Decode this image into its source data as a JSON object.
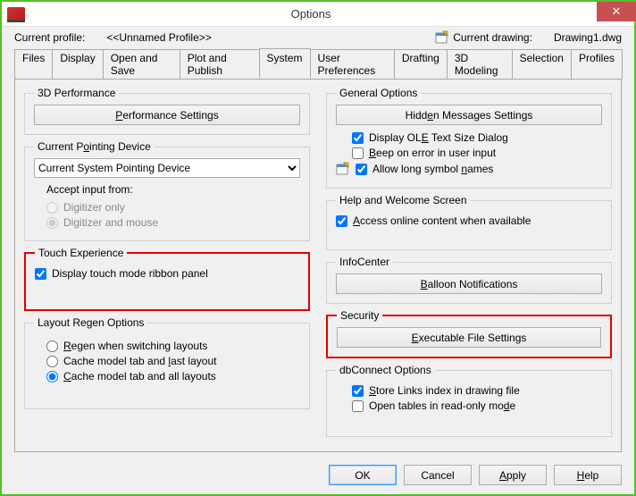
{
  "window": {
    "title": "Options"
  },
  "header": {
    "profile_label": "Current profile:",
    "profile_value": "<<Unnamed Profile>>",
    "drawing_label": "Current drawing:",
    "drawing_value": "Drawing1.dwg"
  },
  "tabs": [
    "Files",
    "Display",
    "Open and Save",
    "Plot and Publish",
    "System",
    "User Preferences",
    "Drafting",
    "3D Modeling",
    "Selection",
    "Profiles"
  ],
  "active_tab": "System",
  "left": {
    "perf_legend": "3D Performance",
    "perf_btn": "Performance Settings",
    "cpd_legend": "Current Pointing Device",
    "cpd_value": "Current System Pointing Device",
    "accept_label": "Accept input from:",
    "radio_digitizer_only": "Digitizer only",
    "radio_digitizer_mouse": "Digitizer and mouse",
    "touch_legend": "Touch Experience",
    "touch_check": "Display touch mode ribbon panel",
    "layout_legend": "Layout Regen Options",
    "radio_regen": "Regen when switching layouts",
    "radio_cache_last": "Cache model tab and last layout",
    "radio_cache_all": "Cache model tab and all layouts"
  },
  "right": {
    "general_legend": "General Options",
    "hidden_btn": "Hidden Messages Settings",
    "ole_check": "Display OLE Text Size Dialog",
    "beep_check": "Beep on error in user input",
    "long_check": "Allow long symbol names",
    "help_legend": "Help and Welcome Screen",
    "access_check": "Access online content when available",
    "info_legend": "InfoCenter",
    "balloon_btn": "Balloon Notifications",
    "security_legend": "Security",
    "exec_btn": "Executable File Settings",
    "db_legend": "dbConnect Options",
    "store_check": "Store Links index in drawing file",
    "readonly_check": "Open tables in read-only mode"
  },
  "footer": {
    "ok": "OK",
    "cancel": "Cancel",
    "apply": "Apply",
    "help": "Help"
  }
}
